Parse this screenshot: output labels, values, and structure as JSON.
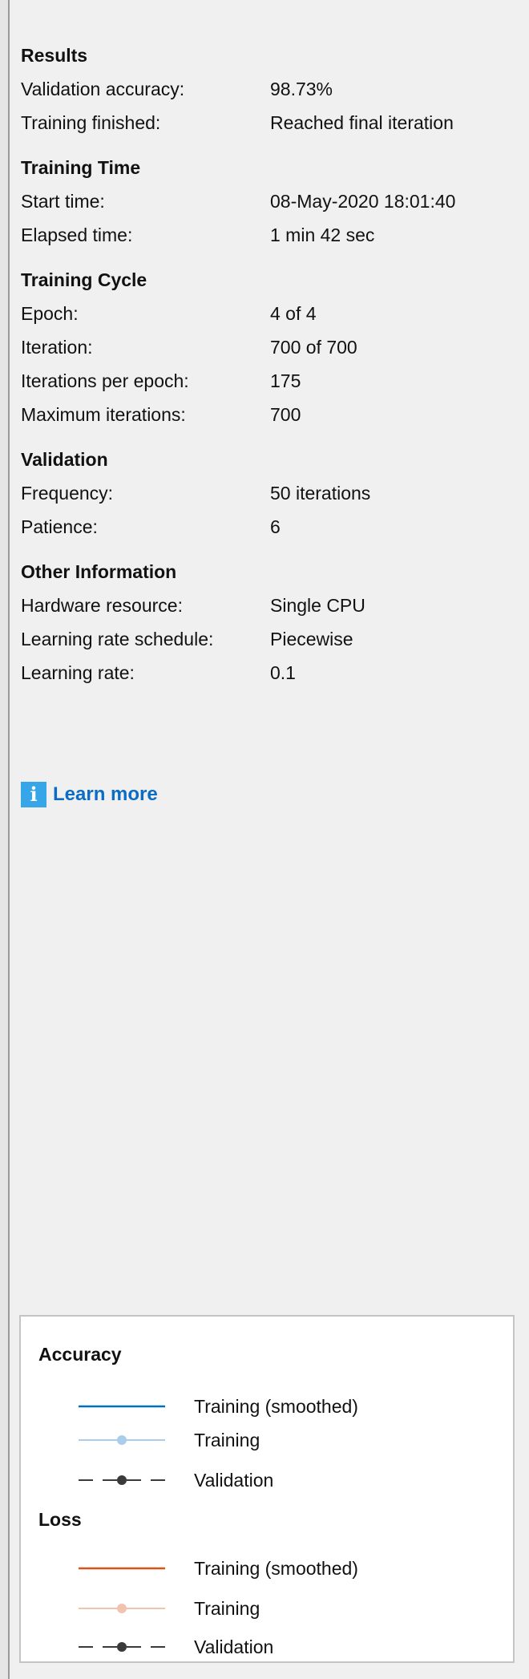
{
  "sections": [
    {
      "title": "Results",
      "rows": [
        {
          "label": "Validation accuracy:",
          "value": "98.73%"
        },
        {
          "label": "Training finished:",
          "value": "Reached final iteration"
        }
      ]
    },
    {
      "title": "Training Time",
      "rows": [
        {
          "label": "Start time:",
          "value": "08-May-2020 18:01:40"
        },
        {
          "label": "Elapsed time:",
          "value": "1 min 42 sec"
        }
      ]
    },
    {
      "title": "Training Cycle",
      "rows": [
        {
          "label": "Epoch:",
          "value": "4 of 4"
        },
        {
          "label": "Iteration:",
          "value": "700 of 700"
        },
        {
          "label": "Iterations per epoch:",
          "value": "175"
        },
        {
          "label": "Maximum iterations:",
          "value": "700"
        }
      ]
    },
    {
      "title": "Validation",
      "rows": [
        {
          "label": "Frequency:",
          "value": "50 iterations"
        },
        {
          "label": "Patience:",
          "value": "6"
        }
      ]
    },
    {
      "title": "Other Information",
      "rows": [
        {
          "label": "Hardware resource:",
          "value": "Single CPU"
        },
        {
          "label": "Learning rate schedule:",
          "value": "Piecewise"
        },
        {
          "label": "Learning rate:",
          "value": "0.1"
        }
      ]
    }
  ],
  "learn_more": {
    "label": "Learn more",
    "icon": "info-icon"
  },
  "legend": {
    "accuracy": {
      "title": "Accuracy",
      "items": [
        {
          "label": "Training (smoothed)",
          "color": "#0072bd"
        },
        {
          "label": "Training",
          "color": "#a9cdeb"
        },
        {
          "label": "Validation",
          "color": "#3a3a3a"
        }
      ]
    },
    "loss": {
      "title": "Loss",
      "items": [
        {
          "label": "Training (smoothed)",
          "color": "#d95319"
        },
        {
          "label": "Training",
          "color": "#f2c4b0"
        },
        {
          "label": "Validation",
          "color": "#3a3a3a"
        }
      ]
    }
  }
}
